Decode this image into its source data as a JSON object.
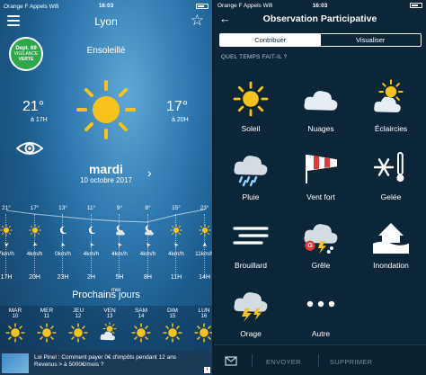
{
  "left": {
    "status": {
      "carrier": "Orange F Appels Wifi",
      "time": "16:03",
      "battery": ""
    },
    "city": "Lyon",
    "vigilance": {
      "dept": "Dept. 69",
      "label": "VIGILANCE",
      "color_label": "VERTE",
      "color": "#2ea84b"
    },
    "condition": "Ensoleillé",
    "temp_min": "21°",
    "temp_min_time": "à 17H",
    "temp_max": "17°",
    "temp_max_time": "à 20H",
    "day": "mardi",
    "date": "10 octobre 2017",
    "hourly": [
      {
        "temp": "21°",
        "icon": "sun-icon",
        "wind": "7km/h",
        "hour": "17H"
      },
      {
        "temp": "17°",
        "icon": "sun-icon",
        "wind": "4km/h",
        "hour": "20H"
      },
      {
        "temp": "13°",
        "icon": "moon-icon",
        "wind": "0km/h",
        "hour": "23H"
      },
      {
        "temp": "11°",
        "icon": "moon-icon",
        "wind": "4km/h",
        "hour": "2H"
      },
      {
        "temp": "9°",
        "icon": "moon-cloud-icon",
        "wind": "4km/h",
        "hour": "5H"
      },
      {
        "temp": "8°",
        "icon": "moon-cloud-icon",
        "wind": "4km/h",
        "hour": "8H"
      },
      {
        "temp": "15°",
        "icon": "sun-icon",
        "wind": "4km/h",
        "hour": "11H"
      },
      {
        "temp": "23°",
        "icon": "sun-icon",
        "wind": "11km/h",
        "hour": "14H"
      }
    ],
    "mer": "mer",
    "prochains": "Prochains jours",
    "daily": [
      {
        "name": "MAR",
        "date": "10",
        "icon": "sun-icon"
      },
      {
        "name": "MER",
        "date": "11",
        "icon": "sun-icon"
      },
      {
        "name": "JEU",
        "date": "12",
        "icon": "sun-icon"
      },
      {
        "name": "VEN",
        "date": "13",
        "icon": "sun-cloud-icon"
      },
      {
        "name": "SAM",
        "date": "14",
        "icon": "sun-icon"
      },
      {
        "name": "DIM",
        "date": "15",
        "icon": "sun-icon"
      },
      {
        "name": "LUN",
        "date": "16",
        "icon": "sun-icon"
      }
    ],
    "ad": {
      "line1": "Loi Pinel : Comment payer 0€ d'impôts pendant 12 ans",
      "line2": "Revenus > à 5000€/mois ?",
      "info": "i"
    }
  },
  "right": {
    "status": {
      "carrier": "Orange F Appels Wifi",
      "time": "16:03"
    },
    "title": "Observation Participative",
    "tabs": [
      "Contribuer",
      "Visualiser"
    ],
    "question": "QUEL TEMPS FAIT-IL ?",
    "options": [
      {
        "label": "Soleil",
        "icon": "sun-icon"
      },
      {
        "label": "Nuages",
        "icon": "cloud-icon"
      },
      {
        "label": "Éclaircies",
        "icon": "sun-cloud-icon"
      },
      {
        "label": "Pluie",
        "icon": "rain-icon"
      },
      {
        "label": "Vent fort",
        "icon": "windsock-icon"
      },
      {
        "label": "Gelée",
        "icon": "snowflake-thermometer-icon"
      },
      {
        "label": "Brouillard",
        "icon": "fog-icon"
      },
      {
        "label": "Grêle",
        "icon": "hail-icon"
      },
      {
        "label": "Inondation",
        "icon": "flood-icon"
      },
      {
        "label": "Orage",
        "icon": "storm-icon"
      },
      {
        "label": "Autre",
        "icon": "more-icon"
      }
    ],
    "footer": {
      "send": "ENVOYER",
      "delete": "SUPPRIMER"
    }
  },
  "colors": {
    "sun": "#f7c21a",
    "accent_green": "#2ea84b",
    "right_bg": "#0c2638"
  }
}
